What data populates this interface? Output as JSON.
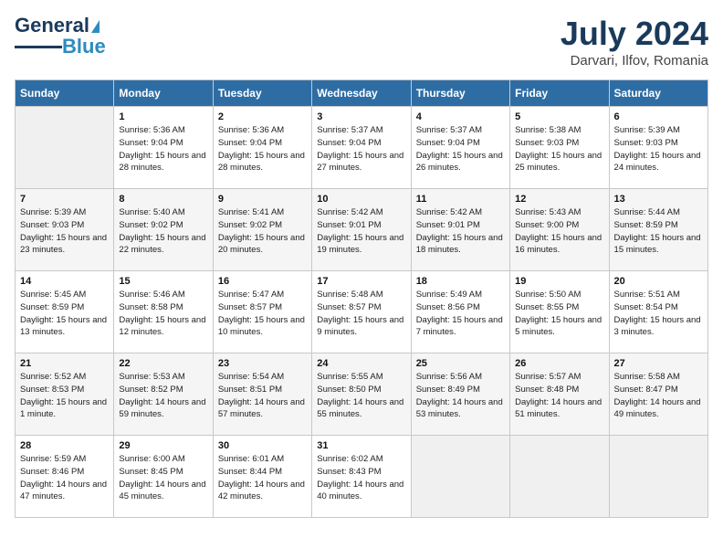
{
  "header": {
    "logo_line1": "General",
    "logo_line2": "Blue",
    "month": "July 2024",
    "location": "Darvari, Ilfov, Romania"
  },
  "weekdays": [
    "Sunday",
    "Monday",
    "Tuesday",
    "Wednesday",
    "Thursday",
    "Friday",
    "Saturday"
  ],
  "weeks": [
    [
      {
        "day": "",
        "empty": true
      },
      {
        "day": "1",
        "sunrise": "5:36 AM",
        "sunset": "9:04 PM",
        "daylight": "15 hours and 28 minutes."
      },
      {
        "day": "2",
        "sunrise": "5:36 AM",
        "sunset": "9:04 PM",
        "daylight": "15 hours and 28 minutes."
      },
      {
        "day": "3",
        "sunrise": "5:37 AM",
        "sunset": "9:04 PM",
        "daylight": "15 hours and 27 minutes."
      },
      {
        "day": "4",
        "sunrise": "5:37 AM",
        "sunset": "9:04 PM",
        "daylight": "15 hours and 26 minutes."
      },
      {
        "day": "5",
        "sunrise": "5:38 AM",
        "sunset": "9:03 PM",
        "daylight": "15 hours and 25 minutes."
      },
      {
        "day": "6",
        "sunrise": "5:39 AM",
        "sunset": "9:03 PM",
        "daylight": "15 hours and 24 minutes."
      }
    ],
    [
      {
        "day": "7",
        "sunrise": "5:39 AM",
        "sunset": "9:03 PM",
        "daylight": "15 hours and 23 minutes."
      },
      {
        "day": "8",
        "sunrise": "5:40 AM",
        "sunset": "9:02 PM",
        "daylight": "15 hours and 22 minutes."
      },
      {
        "day": "9",
        "sunrise": "5:41 AM",
        "sunset": "9:02 PM",
        "daylight": "15 hours and 20 minutes."
      },
      {
        "day": "10",
        "sunrise": "5:42 AM",
        "sunset": "9:01 PM",
        "daylight": "15 hours and 19 minutes."
      },
      {
        "day": "11",
        "sunrise": "5:42 AM",
        "sunset": "9:01 PM",
        "daylight": "15 hours and 18 minutes."
      },
      {
        "day": "12",
        "sunrise": "5:43 AM",
        "sunset": "9:00 PM",
        "daylight": "15 hours and 16 minutes."
      },
      {
        "day": "13",
        "sunrise": "5:44 AM",
        "sunset": "8:59 PM",
        "daylight": "15 hours and 15 minutes."
      }
    ],
    [
      {
        "day": "14",
        "sunrise": "5:45 AM",
        "sunset": "8:59 PM",
        "daylight": "15 hours and 13 minutes."
      },
      {
        "day": "15",
        "sunrise": "5:46 AM",
        "sunset": "8:58 PM",
        "daylight": "15 hours and 12 minutes."
      },
      {
        "day": "16",
        "sunrise": "5:47 AM",
        "sunset": "8:57 PM",
        "daylight": "15 hours and 10 minutes."
      },
      {
        "day": "17",
        "sunrise": "5:48 AM",
        "sunset": "8:57 PM",
        "daylight": "15 hours and 9 minutes."
      },
      {
        "day": "18",
        "sunrise": "5:49 AM",
        "sunset": "8:56 PM",
        "daylight": "15 hours and 7 minutes."
      },
      {
        "day": "19",
        "sunrise": "5:50 AM",
        "sunset": "8:55 PM",
        "daylight": "15 hours and 5 minutes."
      },
      {
        "day": "20",
        "sunrise": "5:51 AM",
        "sunset": "8:54 PM",
        "daylight": "15 hours and 3 minutes."
      }
    ],
    [
      {
        "day": "21",
        "sunrise": "5:52 AM",
        "sunset": "8:53 PM",
        "daylight": "15 hours and 1 minute."
      },
      {
        "day": "22",
        "sunrise": "5:53 AM",
        "sunset": "8:52 PM",
        "daylight": "14 hours and 59 minutes."
      },
      {
        "day": "23",
        "sunrise": "5:54 AM",
        "sunset": "8:51 PM",
        "daylight": "14 hours and 57 minutes."
      },
      {
        "day": "24",
        "sunrise": "5:55 AM",
        "sunset": "8:50 PM",
        "daylight": "14 hours and 55 minutes."
      },
      {
        "day": "25",
        "sunrise": "5:56 AM",
        "sunset": "8:49 PM",
        "daylight": "14 hours and 53 minutes."
      },
      {
        "day": "26",
        "sunrise": "5:57 AM",
        "sunset": "8:48 PM",
        "daylight": "14 hours and 51 minutes."
      },
      {
        "day": "27",
        "sunrise": "5:58 AM",
        "sunset": "8:47 PM",
        "daylight": "14 hours and 49 minutes."
      }
    ],
    [
      {
        "day": "28",
        "sunrise": "5:59 AM",
        "sunset": "8:46 PM",
        "daylight": "14 hours and 47 minutes."
      },
      {
        "day": "29",
        "sunrise": "6:00 AM",
        "sunset": "8:45 PM",
        "daylight": "14 hours and 45 minutes."
      },
      {
        "day": "30",
        "sunrise": "6:01 AM",
        "sunset": "8:44 PM",
        "daylight": "14 hours and 42 minutes."
      },
      {
        "day": "31",
        "sunrise": "6:02 AM",
        "sunset": "8:43 PM",
        "daylight": "14 hours and 40 minutes."
      },
      {
        "day": "",
        "empty": true
      },
      {
        "day": "",
        "empty": true
      },
      {
        "day": "",
        "empty": true
      }
    ]
  ]
}
